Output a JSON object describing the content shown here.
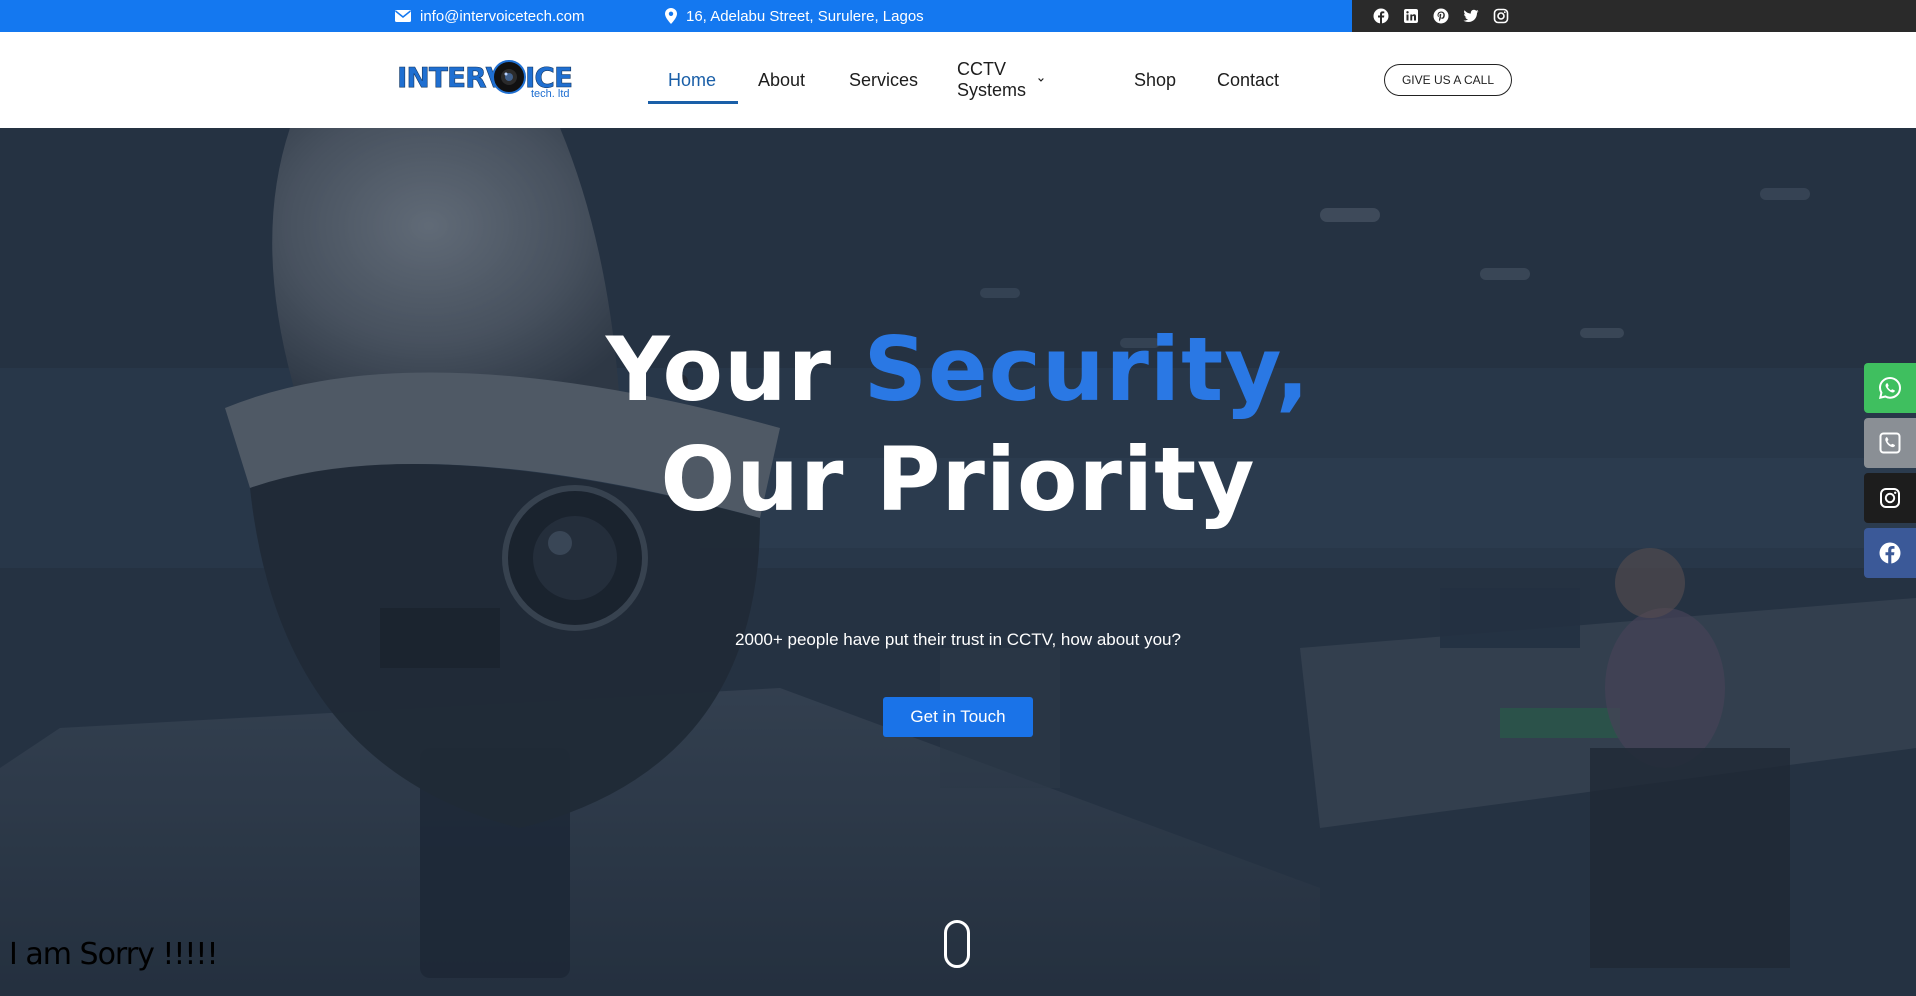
{
  "topbar": {
    "email": "info@intervoicetech.com",
    "address": "16, Adelabu Street, Surulere, Lagos",
    "social_icons": [
      "facebook-icon",
      "linkedin-icon",
      "pinterest-icon",
      "twitter-icon",
      "instagram-icon"
    ]
  },
  "nav": {
    "logo_text": "INTERVOICE",
    "logo_tagline": "tech. ltd",
    "items": [
      {
        "label": "Home"
      },
      {
        "label": "About"
      },
      {
        "label": "Services"
      },
      {
        "label": "CCTV Systems"
      },
      {
        "label": "Shop"
      },
      {
        "label": "Contact"
      }
    ],
    "call_button": "GIVE US A CALL"
  },
  "hero": {
    "title_part1": "Your ",
    "title_accent": "Security,",
    "title_line2": "Our Priority",
    "subtitle": "2000+ people have put their trust in CCTV, how about you?",
    "cta": "Get in Touch"
  },
  "overlay_text": "I am Sorry !!!!!",
  "floating_social": [
    "whatsapp-icon",
    "phone-icon",
    "instagram-icon",
    "facebook-icon"
  ],
  "colors": {
    "brand_blue": "#1478f0",
    "accent": "#2a78e4",
    "whatsapp": "#3fbf5f",
    "facebook": "#3b5998"
  }
}
